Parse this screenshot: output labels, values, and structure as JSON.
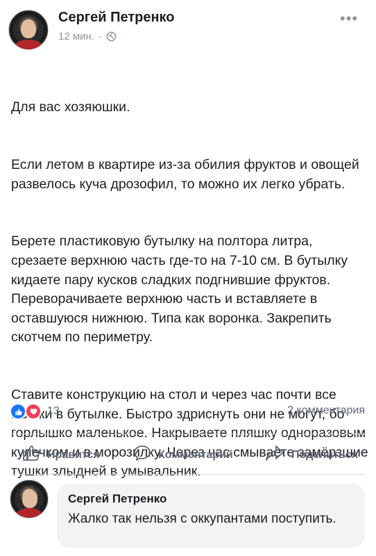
{
  "post": {
    "author": "Сергей Петренко",
    "time": "12 мин.",
    "separator": "·",
    "paragraphs": [
      "Для вас хозяюшки.",
      "Если летом в квартире из-за обилия фруктов и овощей развелось куча дрозофил, то можно их легко убрать.",
      "Берете пластиковую бутылку на полтора литра, срезаете верхнюю часть где-то на 7-10 см. В бутылку кидаете пару кусков сладких подгнившие фруктов. Переворачиваете верхнюю часть и вставляете в оставшуюся нижнюю. Типа как воронка. Закрепить скотчем по периметру.",
      "Ставите конструкцию на стол и через час почти все мошки в бутылке. Быстро здриснуть они не могут, бо горлышко маленькое. Накрываете пляшку одноразовым кулечком и в морозилку. Через час смываете замёрзшие тушки злыдней в умывальник."
    ],
    "reactions_count": "13",
    "comments_count": "2 комментария"
  },
  "actions": {
    "like": "Нравится",
    "comment": "Комментарий",
    "share": "Поделиться"
  },
  "comment": {
    "author": "Сергей Петренко",
    "text": "Жалко так нельзя с оккупантами поступить."
  },
  "icons": {
    "globe": "globe-icon",
    "more": "more-icon",
    "like_reaction": "like-reaction-icon",
    "love_reaction": "love-reaction-icon"
  },
  "colors": {
    "accent": "#1877f2",
    "love": "#f33e58",
    "secondary_text": "#90949c"
  }
}
